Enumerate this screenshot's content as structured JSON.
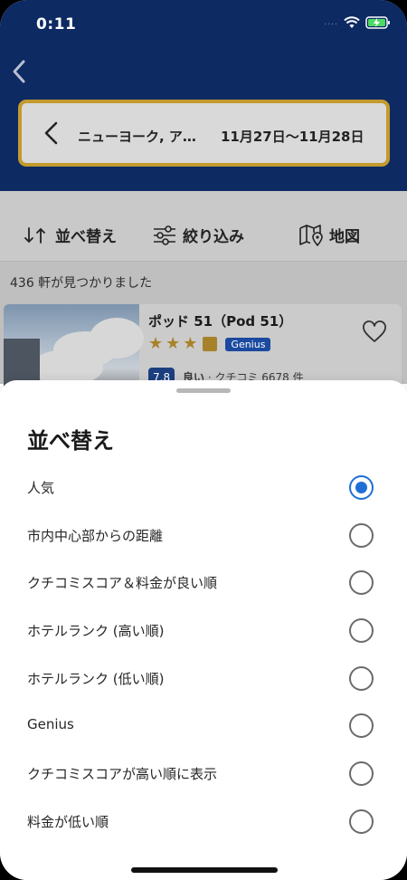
{
  "status_bar": {
    "time": "0:11",
    "signal": "...."
  },
  "search": {
    "destination": "ニューヨーク, ア…",
    "dates": "11月27日〜11月28日"
  },
  "toolbar": {
    "sort_label": "並べ替え",
    "filter_label": "絞り込み",
    "map_label": "地図"
  },
  "results": {
    "count_text": "436 軒が見つかりました",
    "hotel": {
      "name": "ポッド 51（Pod 51）",
      "stars": 3,
      "genius_label": "Genius",
      "score": "7.8",
      "rating_word": "良い",
      "review_text": " · クチコミ 6678 件"
    }
  },
  "sort_sheet": {
    "title": "並べ替え",
    "selected_index": 0,
    "options": [
      "人気",
      "市内中心部からの距離",
      "クチコミスコア＆料金が良い順",
      "ホテルランク (高い順)",
      "ホテルランク (低い順)",
      "Genius",
      "クチコミスコアが高い順に表示",
      "料金が低い順"
    ]
  },
  "colors": {
    "header_bg": "#0d2a63",
    "search_border": "#c39a2e",
    "radio_selected": "#1f6fd6",
    "genius_badge": "#1b4aa0"
  }
}
